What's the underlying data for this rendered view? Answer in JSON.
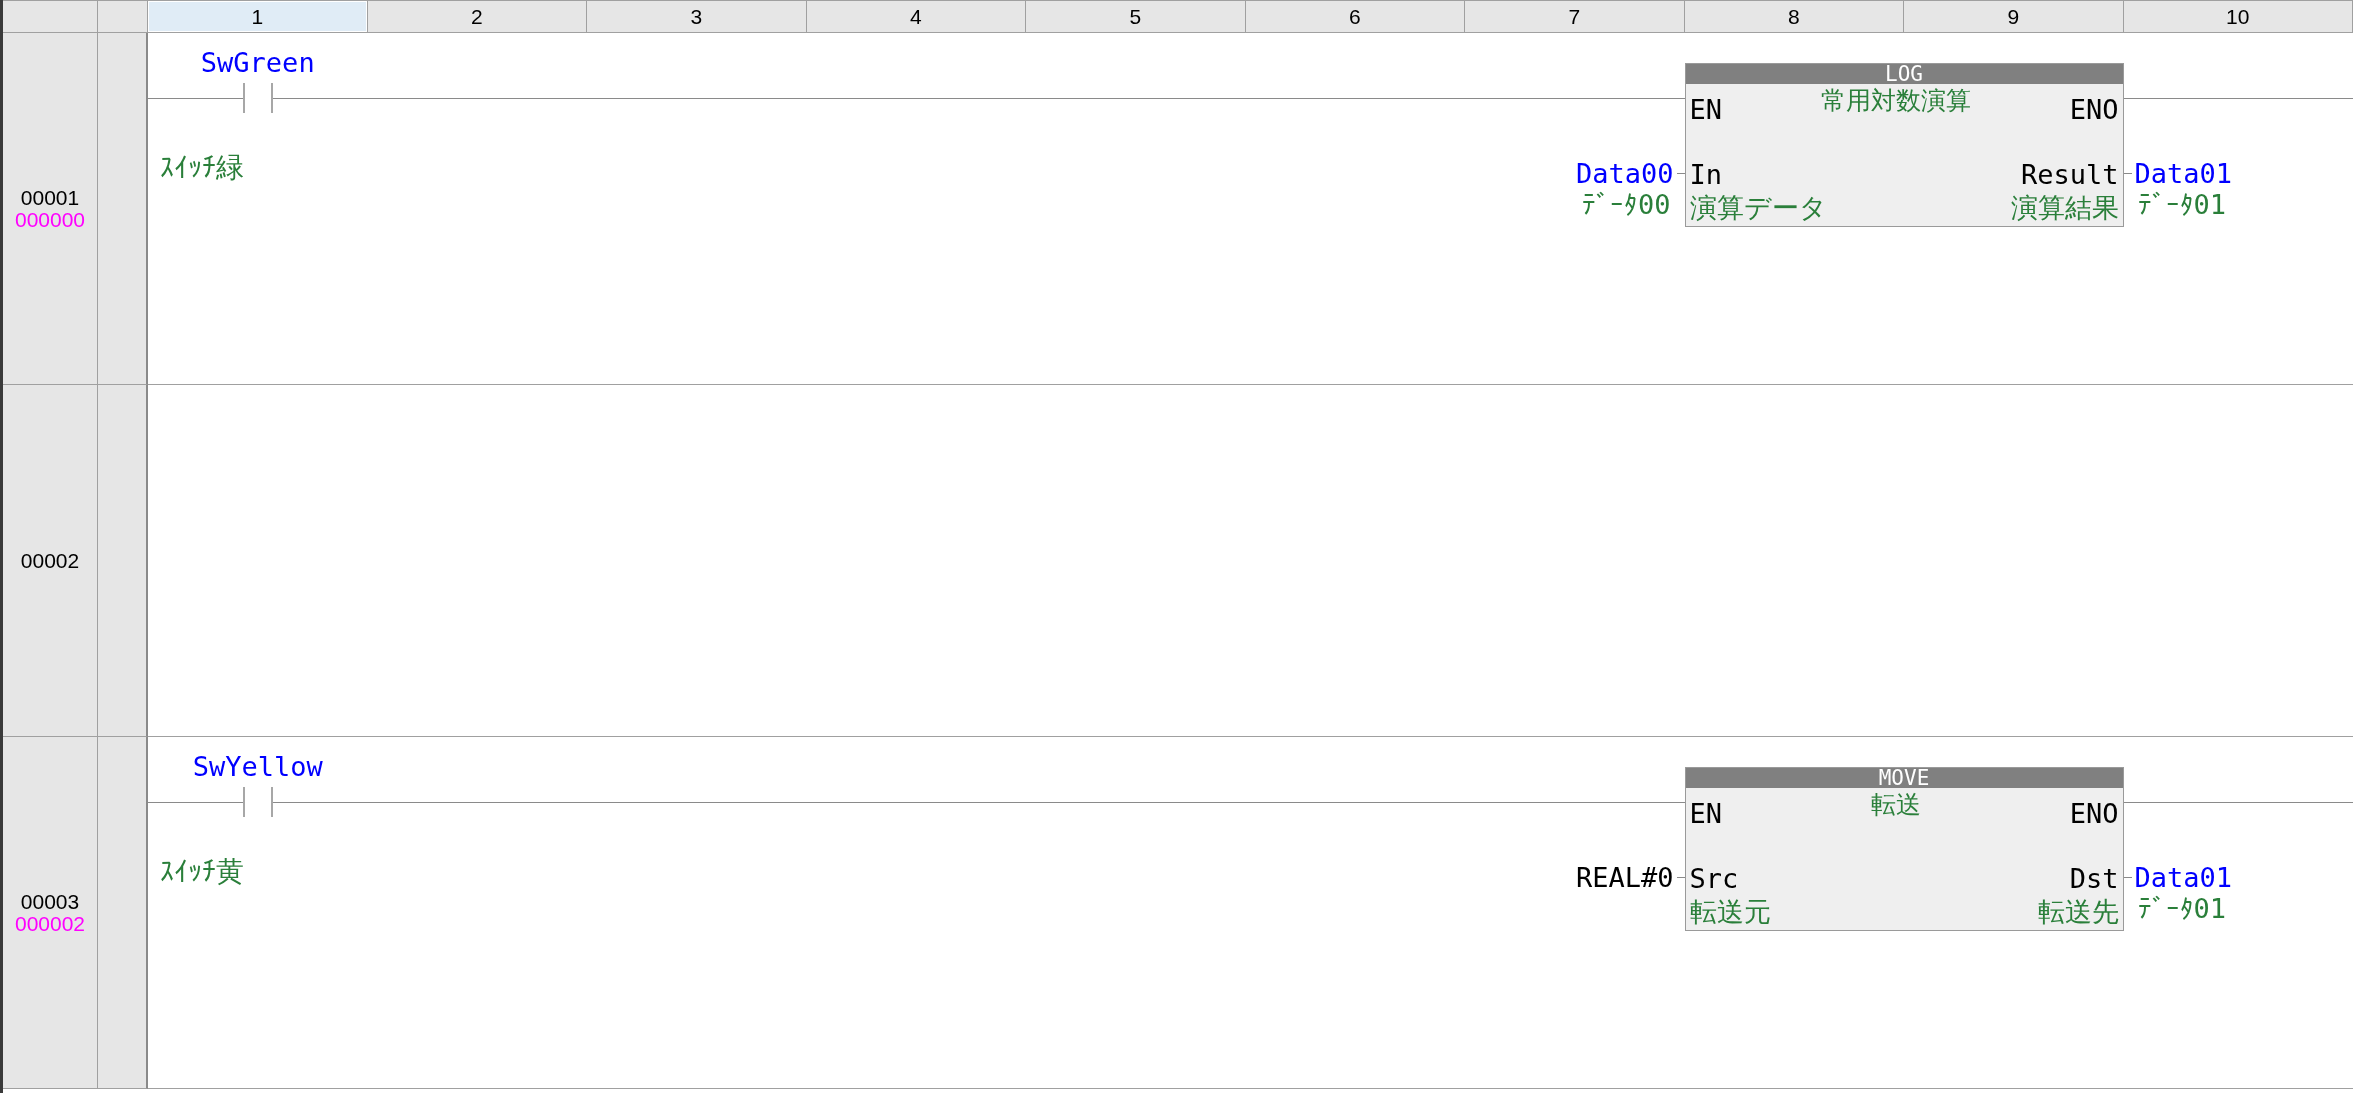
{
  "columns": [
    {
      "label": "1",
      "selected": true
    },
    {
      "label": "2",
      "selected": false
    },
    {
      "label": "3",
      "selected": false
    },
    {
      "label": "4",
      "selected": false
    },
    {
      "label": "5",
      "selected": false
    },
    {
      "label": "6",
      "selected": false
    },
    {
      "label": "7",
      "selected": false
    },
    {
      "label": "8",
      "selected": false
    },
    {
      "label": "9",
      "selected": false
    },
    {
      "label": "10",
      "selected": false
    }
  ],
  "rungs": [
    {
      "number": "00001",
      "step": "000000",
      "contact": {
        "name": "SwGreen",
        "comment": "ｽｲｯﾁ緑"
      },
      "block": {
        "title": "LOG",
        "comment": "常用対数演算",
        "en": "EN",
        "eno": "ENO",
        "input": {
          "pin": "In",
          "pin_comment": "演算データ",
          "operand": "Data00",
          "operand_comment": "ﾃﾞｰﾀ00",
          "kind": "variable"
        },
        "output": {
          "pin": "Result",
          "pin_comment": "演算結果",
          "operand": "Data01",
          "operand_comment": "ﾃﾞｰﾀ01",
          "kind": "variable"
        }
      }
    },
    {
      "number": "00002"
    },
    {
      "number": "00003",
      "step": "000002",
      "contact": {
        "name": "SwYellow",
        "comment": "ｽｲｯﾁ黄"
      },
      "block": {
        "title": "MOVE",
        "comment": "転送",
        "en": "EN",
        "eno": "ENO",
        "input": {
          "pin": "Src",
          "pin_comment": "転送元",
          "operand": "REAL#0",
          "kind": "constant"
        },
        "output": {
          "pin": "Dst",
          "pin_comment": "転送先",
          "operand": "Data01",
          "operand_comment": "ﾃﾞｰﾀ01",
          "kind": "variable"
        }
      }
    }
  ]
}
